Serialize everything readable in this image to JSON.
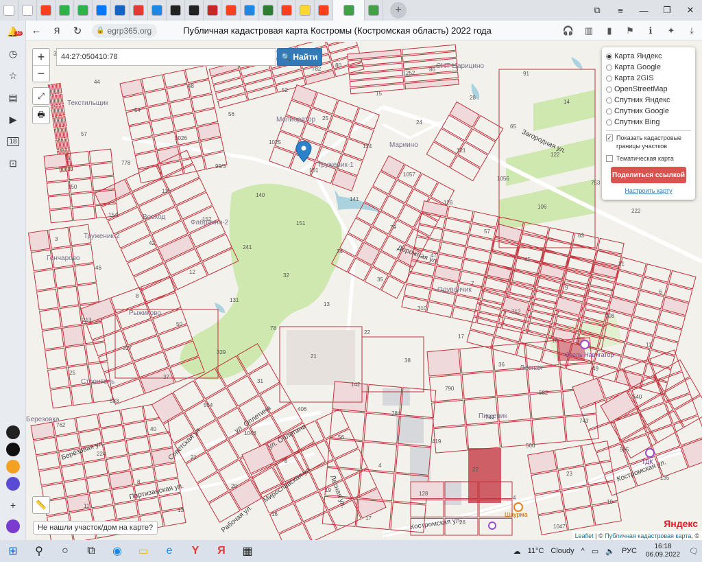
{
  "browser": {
    "tabs": [
      {
        "icon": "yandex-18-icon",
        "color": "#ffffff"
      },
      {
        "icon": "folder-icon",
        "color": "#ffffff"
      },
      {
        "icon": "yandex-icon",
        "color": "#fc3f1d"
      },
      {
        "icon": "colorful-app-icon",
        "color": "#2db34a"
      },
      {
        "icon": "colorful-app-icon",
        "color": "#2db34a"
      },
      {
        "icon": "vk-icon",
        "color": "#0077ff"
      },
      {
        "icon": "mail-icon",
        "color": "#1565c0"
      },
      {
        "icon": "document-icon",
        "color": "#e53935"
      },
      {
        "icon": "id-icon",
        "color": "#1e88e5"
      },
      {
        "icon": "link-icon",
        "color": "#222222"
      },
      {
        "icon": "link-icon",
        "color": "#222222"
      },
      {
        "icon": "chart-icon",
        "color": "#c62828"
      },
      {
        "icon": "yandex-icon",
        "color": "#fc3f1d"
      },
      {
        "icon": "puzzle-icon",
        "color": "#1e88e5"
      },
      {
        "icon": "refresh-app-icon",
        "color": "#2e7d32"
      },
      {
        "icon": "yandex-icon",
        "color": "#fc3f1d"
      },
      {
        "icon": "taxi-icon",
        "color": "#fdd835"
      },
      {
        "icon": "yandex-icon",
        "color": "#fc3f1d"
      },
      {
        "icon": "check-shield-icon",
        "color": "#43a047"
      },
      {
        "icon": "check-shield-icon",
        "color": "#43a047"
      }
    ],
    "domain": "egrp365.org",
    "page_title": "Публичная кадастровая карта Костромы (Костромская область) 2022 года",
    "sidebar_badges": {
      "notifications": "10",
      "age": "18"
    }
  },
  "map": {
    "search": {
      "value": "44:27:050410:78"
    },
    "search_button": "Найти",
    "layers": [
      {
        "label": "Карта Яндекс",
        "selected": true
      },
      {
        "label": "Карта Google",
        "selected": false
      },
      {
        "label": "Карта 2GIS",
        "selected": false
      },
      {
        "label": "OpenStreetMap",
        "selected": false
      },
      {
        "label": "Спутник Яндекс",
        "selected": false
      },
      {
        "label": "Спутник Google",
        "selected": false
      },
      {
        "label": "Спутник Bing",
        "selected": false
      }
    ],
    "options": {
      "show_cadastral": "Показать кадастровые границы участков",
      "thematic": "Тематическая карта"
    },
    "share_button": "Поделиться ссылкой",
    "configure_link": "Настроить карту",
    "not_found": "Не нашли участок/дом на карте?",
    "attribution": {
      "leaflet": "Leaflet",
      "sep": " | © ",
      "cadastral": "Публичная кадастровая карта",
      "tail": ", ©"
    },
    "logo": "Яндекс",
    "district_labels": [
      "Текстильщик",
      "Мелиоратор",
      "Труженик-1",
      "Труженик-2",
      "Восход",
      "Фабрично-2",
      "Мариино",
      "СНТ Царицино",
      "Строитель",
      "Березовка",
      "Одуванчик",
      "Рыжиково",
      "Лесная",
      "Гончарово",
      "Пищевик"
    ],
    "street_labels": [
      "Костромская ул.",
      "Костромская ул.",
      "ул. Оплетина",
      "ул. Оплетина",
      "Мирославская ул.",
      "Партизанская ул.",
      "Рабочая ул.",
      "Берёзовая ул.",
      "Лесная ул.",
      "Советская ул.",
      "Дорожная ул.",
      "Загородная ул."
    ],
    "poi": {
      "hotel": "Отель Навигатор",
      "shawarma": "Шаурма",
      "tdk": "ТДК"
    },
    "parcel_numbers": [
      "308",
      "72",
      "76",
      "80",
      "86",
      "91",
      "39",
      "44",
      "48",
      "52",
      "15",
      "28",
      "14",
      "13",
      "54",
      "56",
      "25",
      "24",
      "65",
      "96",
      "57",
      "1026",
      "1025",
      "124",
      "121",
      "122",
      "131",
      "778",
      "99/3",
      "101",
      "1057",
      "1056",
      "753",
      "150",
      "115",
      "140",
      "141",
      "126",
      "106",
      "222",
      "154",
      "152",
      "151",
      "79",
      "57",
      "63",
      "3",
      "42",
      "241",
      "34",
      "47",
      "45",
      "31",
      "46",
      "12",
      "32",
      "35",
      "7",
      "9",
      "6",
      "8",
      "131",
      "13",
      "310",
      "312",
      "308",
      "213",
      "50",
      "78",
      "22",
      "17",
      "18",
      "11",
      "327",
      "329",
      "21",
      "38",
      "36",
      "49",
      "25",
      "37",
      "31",
      "142",
      "790",
      "582",
      "540",
      "583",
      "554",
      "406",
      "784",
      "741",
      "743",
      "762",
      "40",
      "1048",
      "56",
      "419",
      "566",
      "565",
      "224",
      "21",
      "6",
      "4",
      "22",
      "23",
      "135",
      "8",
      "20",
      "19",
      "128",
      "4",
      "10",
      "11",
      "13",
      "16",
      "17",
      "26",
      "1047",
      "1040",
      "1049",
      "747",
      "782",
      "252"
    ],
    "weather": {
      "temp": "11°C",
      "condition": "Cloudy"
    }
  },
  "taskbar": {
    "lang": "РУС",
    "time": "16:18",
    "date": "06.09.2022"
  },
  "colors": {
    "parcel_stroke": "#c0323c",
    "parcel_fill": "#ffffff",
    "road": "#ffffff",
    "green": "#cfe8b0",
    "water": "#aad3df",
    "building": "#d9d0c9",
    "search_blue": "#337ab7",
    "share_red": "#d9534f"
  }
}
